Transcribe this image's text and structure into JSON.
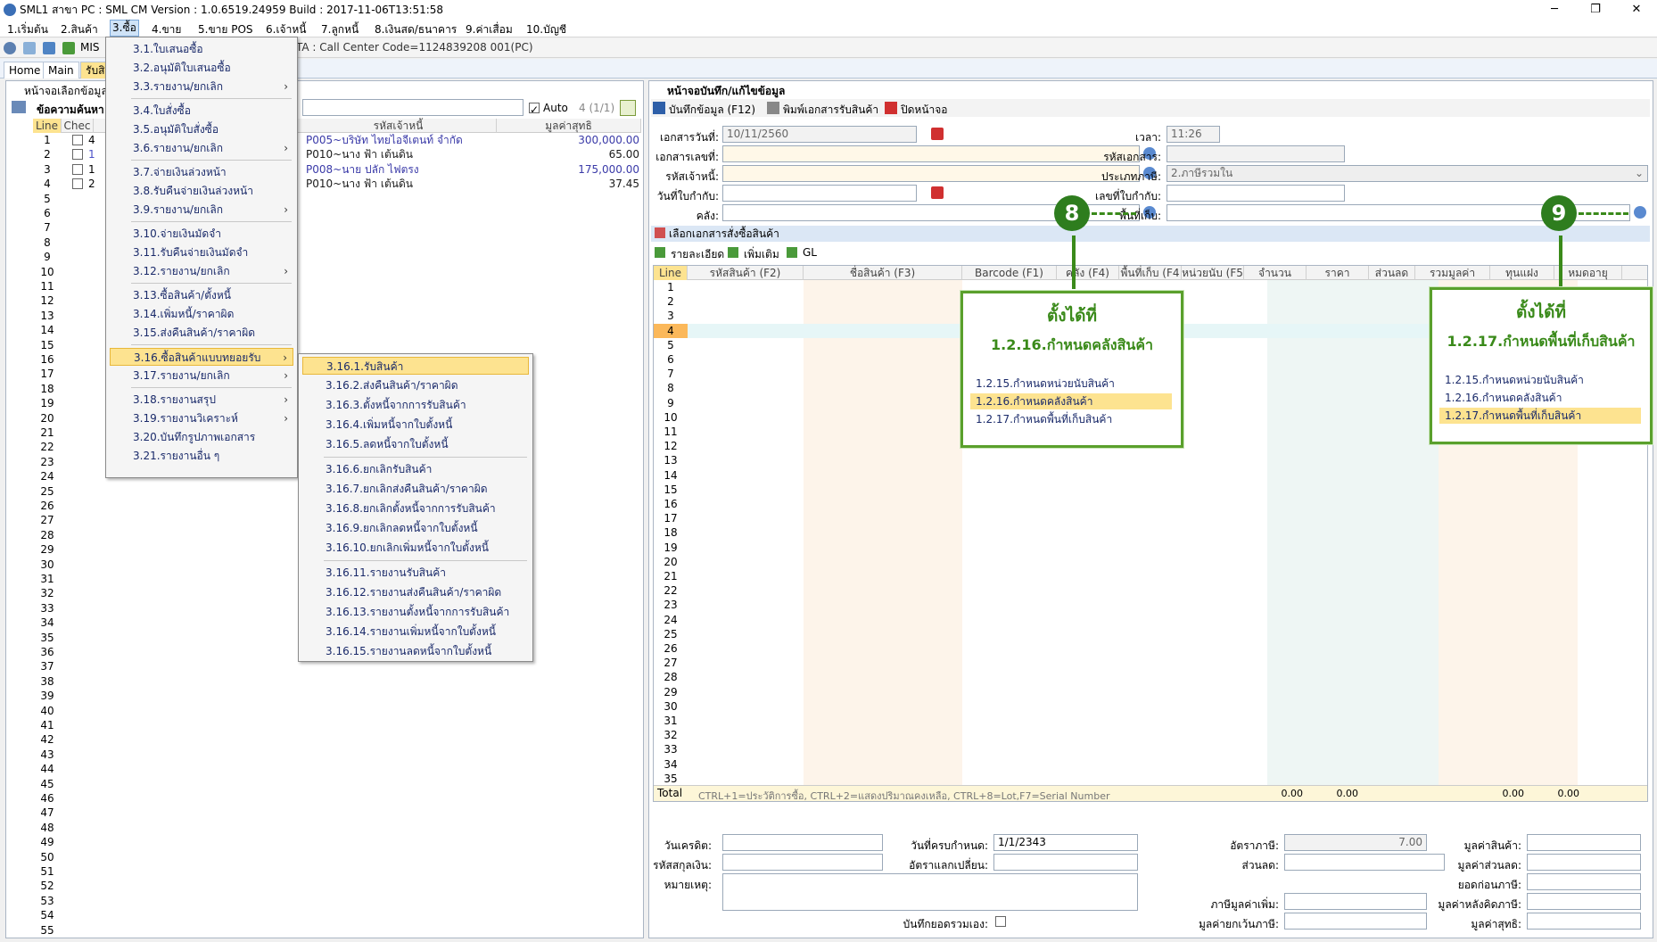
{
  "window": {
    "title": "SML1 สาขา PC : SML CM Version : 1.0.6519.24959  Build : 2017-11-06T13:51:58"
  },
  "menubar": [
    "1.เริ่มต้น",
    "2.สินค้า",
    "3.ซื้อ",
    "4.ขาย",
    "5.ขาย POS",
    "6.เจ้าหนี้",
    "7.ลูกหนี้",
    "8.เงินสด/ธนาคาร",
    "9.ค่าเสื่อม",
    "10.บัญชี"
  ],
  "toolbar": {
    "mis": "MIS",
    "status": "TA : Call Center Code=1124839208 001(PC)"
  },
  "tabs": [
    "Home",
    "Main",
    "รับสิ"
  ],
  "left_panel": {
    "title": "หน้าจอเลือกข้อมูล",
    "search_label": "ข้อความค้นหา",
    "auto_label": "Auto",
    "count": "4 (1/1)",
    "col_line": "Line",
    "col_check": "Chec",
    "col_supplier": "รหัสเจ้าหนี้",
    "col_net": "มูลค่าสุทธิ",
    "rows": [
      {
        "n": "1",
        "code": "4",
        "supplier": "P005~บริษัท ไทยไอจีเตนท์ จำกัด",
        "net": "300,000.00"
      },
      {
        "n": "2",
        "code": "1",
        "supplier": "P010~นาง ฟ้า เต้นดิน",
        "net": "65.00"
      },
      {
        "n": "3",
        "code": "1",
        "supplier": "P008~นาย ปลัก ไฟตรง",
        "net": "175,000.00"
      },
      {
        "n": "4",
        "code": "2",
        "supplier": "P010~นาง ฟ้า เต้นดิน",
        "net": "37.45"
      }
    ],
    "line_numbers": [
      "1",
      "2",
      "3",
      "4",
      "5",
      "6",
      "7",
      "8",
      "9",
      "10",
      "11",
      "12",
      "13",
      "14",
      "15",
      "16",
      "17",
      "18",
      "19",
      "20",
      "21",
      "22",
      "23",
      "24",
      "25",
      "26",
      "27",
      "28",
      "29",
      "30",
      "31",
      "32",
      "33",
      "34",
      "35",
      "36",
      "37",
      "38",
      "39",
      "40",
      "41",
      "42",
      "43",
      "44",
      "45",
      "46",
      "47",
      "48",
      "49",
      "50",
      "51",
      "52",
      "53",
      "54",
      "55"
    ]
  },
  "menu_main": {
    "items": [
      {
        "label": "3.1.ใบเสนอซื้อ"
      },
      {
        "label": "3.2.อนุมัติใบเสนอซื้อ"
      },
      {
        "label": "3.3.รายงาน/ยกเลิก",
        "sub": true
      },
      {
        "label": "3.4.ใบสั่งซื้อ"
      },
      {
        "label": "3.5.อนุมัติใบสั่งซื้อ"
      },
      {
        "label": "3.6.รายงาน/ยกเลิก",
        "sub": true
      },
      {
        "label": "3.7.จ่ายเงินล่วงหน้า"
      },
      {
        "label": "3.8.รับคืนจ่ายเงินล่วงหน้า"
      },
      {
        "label": "3.9.รายงาน/ยกเลิก",
        "sub": true
      },
      {
        "label": "3.10.จ่ายเงินมัดจำ"
      },
      {
        "label": "3.11.รับคืนจ่ายเงินมัดจำ"
      },
      {
        "label": "3.12.รายงาน/ยกเลิก",
        "sub": true
      },
      {
        "label": "3.13.ซื้อสินค้า/ตั้งหนี้"
      },
      {
        "label": "3.14.เพิ่มหนี้/ราคาผิด"
      },
      {
        "label": "3.15.ส่งคืนสินค้า/ราคาผิด"
      },
      {
        "label": "3.16.ซื้อสินค้าแบบทยอยรับ",
        "sub": true,
        "hl": true
      },
      {
        "label": "3.17.รายงาน/ยกเลิก",
        "sub": true
      },
      {
        "label": "3.18.รายงานสรุป",
        "sub": true
      },
      {
        "label": "3.19.รายงานวิเคราะห์",
        "sub": true
      },
      {
        "label": "3.20.บันทึกรูปภาพเอกสาร"
      },
      {
        "label": "3.21.รายงานอื่น ๆ"
      }
    ]
  },
  "menu_sub": {
    "items": [
      {
        "label": "3.16.1.รับสินค้า",
        "hl": true
      },
      {
        "label": "3.16.2.ส่งคืนสินค้า/ราคาผิด"
      },
      {
        "label": "3.16.3.ตั้งหนี้จากการรับสินค้า"
      },
      {
        "label": "3.16.4.เพิ่มหนี้จากใบตั้งหนี้"
      },
      {
        "label": "3.16.5.ลดหนี้จากใบตั้งหนี้"
      },
      {
        "label": "3.16.6.ยกเลิกรับสินค้า"
      },
      {
        "label": "3.16.7.ยกเลิกส่งคืนสินค้า/ราคาผิด"
      },
      {
        "label": "3.16.8.ยกเลิกตั้งหนี้จากการรับสินค้า"
      },
      {
        "label": "3.16.9.ยกเลิกลดหนี้จากใบตั้งหนี้"
      },
      {
        "label": "3.16.10.ยกเลิกเพิ่มหนี้จากใบตั้งหนี้"
      },
      {
        "label": "3.16.11.รายงานรับสินค้า"
      },
      {
        "label": "3.16.12.รายงานส่งคืนสินค้า/ราคาผิด"
      },
      {
        "label": "3.16.13.รายงานตั้งหนี้จากการรับสินค้า"
      },
      {
        "label": "3.16.14.รายงานเพิ่มหนี้จากใบตั้งหนี้"
      },
      {
        "label": "3.16.15.รายงานลดหนี้จากใบตั้งหนี้"
      }
    ]
  },
  "right_panel": {
    "title": "หน้าจอบันทึก/แก้ไขข้อมูล",
    "save_btn": "บันทึกข้อมูล (F12)",
    "print_btn": "พิมพ์เอกสารรับสินค้า",
    "close_btn": "ปิดหน้าจอ",
    "doc_date_label": "เอกสารวันที่:",
    "doc_date": "10/11/2560",
    "time_label": "เวลา:",
    "time": "11:26",
    "doc_no_label": "เอกสารเลขที่:",
    "doc_code_label": "รหัสเอกสาร:",
    "supplier_label": "รหัสเจ้าหนี้:",
    "tax_type_label": "ประเภทภาษี:",
    "tax_type": "2.ภาษีรวมใน",
    "invoice_date_label": "วันที่ใบกำกับ:",
    "invoice_no_label": "เลขที่ใบกำกับ:",
    "warehouse_label": "คลัง:",
    "location_label": "พื้นที่เก็บ:",
    "select_po": "เลือกเอกสารสั่งซื้อสินค้า",
    "subtabs": [
      "รายละเอียด",
      "เพิ่มเติม",
      "GL"
    ],
    "grid_headers": [
      "Line",
      "รหัสสินค้า (F2)",
      "ชื่อสินค้า (F3)",
      "Barcode (F1)",
      "คลัง (F4)",
      "พื้นที่เก็บ (F4",
      "หน่วยนับ (F5",
      "จำนวน",
      "ราคา",
      "ส่วนลด",
      "รวมมูลค่า",
      "ทุนแฝง",
      "หมดอายุ"
    ],
    "grid_rows": [
      "1",
      "2",
      "3",
      "4",
      "5",
      "6",
      "7",
      "8",
      "9",
      "10",
      "11",
      "12",
      "13",
      "14",
      "15",
      "16",
      "17",
      "18",
      "19",
      "20",
      "21",
      "22",
      "23",
      "24",
      "25",
      "26",
      "27",
      "28",
      "29",
      "30",
      "31",
      "32",
      "33",
      "34",
      "35"
    ],
    "total_label": "Total",
    "hint": "CTRL+1=ประวัติการซื้อ, CTRL+2=แสดงปริมาณคงเหลือ, CTRL+8=Lot,F7=Serial Number",
    "totals": [
      "0.00",
      "0.00",
      "0.00",
      "0.00"
    ],
    "credit_days_label": "วันเครดิต:",
    "due_date_label": "วันที่ครบกำหนด:",
    "due_date": "1/1/2343",
    "currency_label": "รหัสสกุลเงิน:",
    "exchange_label": "อัตราแลกเปลี่ยน:",
    "remark_label": "หมายเหตุ:",
    "tax_rate_label": "อัตราภาษี:",
    "tax_rate": "7.00",
    "discount_label": "ส่วนลด:",
    "vat_label": "ภาษีมูลค่าเพิ่ม:",
    "exempt_label": "มูลค่ายกเว้นภาษี:",
    "self_total_label": "บันทึกยอดรวมเอง:",
    "goods_value_label": "มูลค่าสินค้า:",
    "discount_value_label": "มูลค่าส่วนลด:",
    "before_tax_label": "ยอดก่อนภาษี:",
    "after_tax_label": "มูลค่าหลังคิดภาษี:",
    "net_value_label": "มูลค่าสุทธิ:"
  },
  "callout8": {
    "badge": "8",
    "line1": "ตั้งได้ที่",
    "line2": "1.2.16.กำหนดคลังสินค้า",
    "items": [
      "1.2.15.กำหนดหน่วยนับสินค้า",
      "1.2.16.กำหนดคลังสินค้า",
      "1.2.17.กำหนดพื้นที่เก็บสินค้า"
    ]
  },
  "callout9": {
    "badge": "9",
    "line1": "ตั้งได้ที่",
    "line2": "1.2.17.กำหนดพื้นที่เก็บสินค้า",
    "items": [
      "1.2.15.กำหนดหน่วยนับสินค้า",
      "1.2.16.กำหนดคลังสินค้า",
      "1.2.17.กำหนดพื้นที่เก็บสินค้า"
    ]
  }
}
